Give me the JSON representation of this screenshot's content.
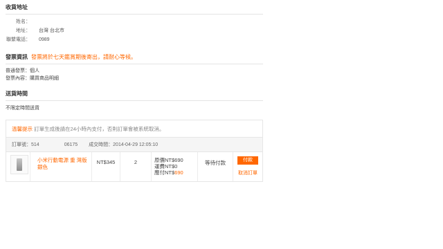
{
  "address": {
    "title": "收貨地址",
    "rows": [
      {
        "label": "姓名：",
        "value": ""
      },
      {
        "label": "地址：",
        "value": "台灣 台北市"
      },
      {
        "label": "聯繫電話：",
        "value": "0989"
      }
    ]
  },
  "invoice": {
    "title": "發票資訊",
    "note": "發票將於七天鑑賞期後寄出，請耐心等候。",
    "type_line": "普通發票：個人",
    "content_line": "發票內容：購買商品明細"
  },
  "delivery": {
    "title": "送貨時間",
    "value": "不限定時間送貨"
  },
  "order": {
    "tip_label": "溫馨提示",
    "tip_text": "訂單生成後請在24小時內支付，否則訂單會被系統取消。",
    "number_label": "訂單號：",
    "number_prefix": "514",
    "number_suffix": "06175",
    "time_text": "成交時間：2014-04-29 12:05:10",
    "item": {
      "name": "小米行動電源 重 灣版 銀色",
      "price": "NT$345",
      "qty": "2",
      "orig_price": "原價NT$690",
      "shipping": "運費NT$0",
      "due_label": "應付NT$",
      "due_value": "690",
      "status": "等待付款",
      "pay_label": "付款",
      "cancel_label": "取消訂單"
    }
  }
}
